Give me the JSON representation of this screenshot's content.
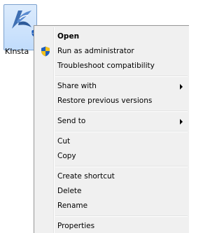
{
  "desktop_icon": {
    "caption": "KInsta",
    "icon_name": "kinsta-logo-icon",
    "accent": "#3f6fb2"
  },
  "context_menu": {
    "items": [
      {
        "label": "Open"
      },
      {
        "label": "Run as administrator",
        "icon": "uac-shield-icon"
      },
      {
        "label": "Troubleshoot compatibility"
      },
      {
        "label": "Share with",
        "submenu": true
      },
      {
        "label": "Restore previous versions"
      },
      {
        "label": "Send to",
        "submenu": true
      },
      {
        "label": "Cut"
      },
      {
        "label": "Copy"
      },
      {
        "label": "Create shortcut"
      },
      {
        "label": "Delete"
      },
      {
        "label": "Rename"
      },
      {
        "label": "Properties"
      }
    ]
  }
}
